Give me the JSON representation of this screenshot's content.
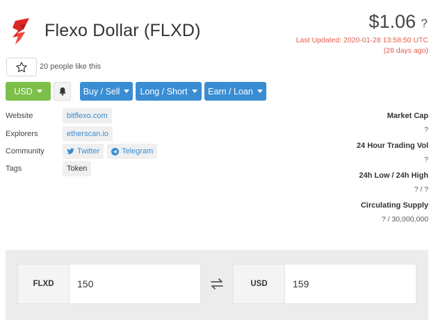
{
  "coin": {
    "title": "Flexo Dollar (FLXD)",
    "price": "$1.06",
    "price_help": "?",
    "last_updated": "Last Updated: 2020-01-28 13:58:50 UTC",
    "updated_ago": "(28 days ago)",
    "logo_color": "#e02424"
  },
  "likes": {
    "text": "20 people like this"
  },
  "toolbar": {
    "currency": "USD",
    "buttons": [
      "Buy / Sell",
      "Long / Short",
      "Earn / Loan"
    ],
    "accent_green": "#7cc04a",
    "accent_blue": "#3a8dd3"
  },
  "info": {
    "website_label": "Website",
    "website_link": "bitflexo.com",
    "explorers_label": "Explorers",
    "explorers_link": "etherscan.io",
    "community_label": "Community",
    "twitter": "Twitter",
    "telegram": "Telegram",
    "tags_label": "Tags",
    "tag": "Token"
  },
  "stats": [
    {
      "label": "Market Cap",
      "value": "?"
    },
    {
      "label": "24 Hour Trading Vol",
      "value": "?"
    },
    {
      "label": "24h Low / 24h High",
      "value": "? / ?"
    },
    {
      "label": "Circulating Supply",
      "value": "? / 30,000,000"
    }
  ],
  "converter": {
    "from_code": "FLXD",
    "from_value": "150",
    "to_code": "USD",
    "to_value": "159"
  }
}
